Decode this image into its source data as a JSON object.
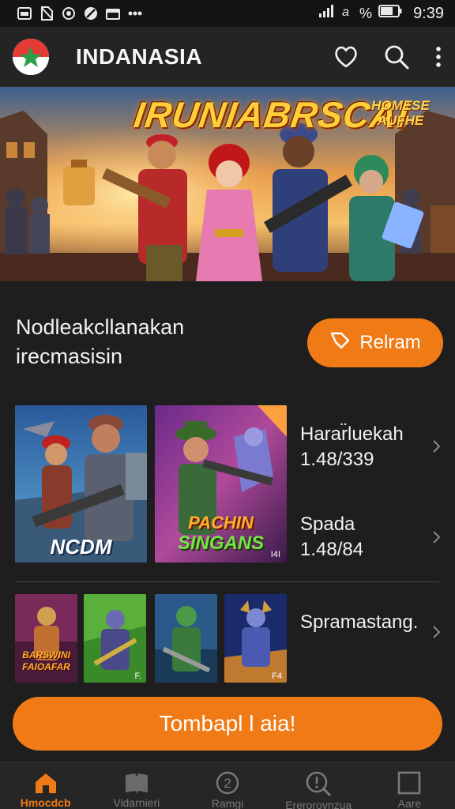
{
  "status_bar": {
    "battery_percent": "%",
    "time": "9:39",
    "icons": [
      "gallery-icon",
      "no-sim-icon",
      "sync-icon",
      "mute-icon",
      "calendar-icon",
      "more-dots-icon",
      "signal-icon",
      "wifi-icon",
      "battery-icon"
    ]
  },
  "app_bar": {
    "title": "INDANASIA",
    "icons": [
      "logo-icon",
      "heart-icon",
      "search-icon",
      "overflow-menu-icon"
    ]
  },
  "hero": {
    "title": "IRUNIABRSCAI",
    "badge_line1": "HOMESE",
    "badge_line2": "AUFHE"
  },
  "promo": {
    "line1": "Nodleakcllanakan",
    "line2": "irecmasisin",
    "button_label": "Relram",
    "button_icon": "tag-icon",
    "accent": "#f07a16"
  },
  "featured": {
    "card1_label": "NCDM",
    "card2_label_line1": "PACHIN",
    "card2_label_line2": "SINGANS",
    "card2_corner": "I4I",
    "item1_title": "Harar̈luekah",
    "item1_value": "1.48/339",
    "item2_title": "Spada",
    "item2_value": "1.48/84"
  },
  "more": {
    "thumb1_label_line1": "BARSWINI",
    "thumb1_label_line2": "FAIOAFAR",
    "thumb2_corner": "F.",
    "thumb4_corner": "F4",
    "title": "Spramastang."
  },
  "cta": {
    "label": "Tombapl l aia!"
  },
  "bottom_nav": {
    "items": [
      {
        "label": "Hmocdcb",
        "icon": "home-icon",
        "active": true
      },
      {
        "label": "Vidarnieri",
        "icon": "library-icon",
        "active": false
      },
      {
        "label": "Ramgi",
        "icon": "help-icon",
        "active": false
      },
      {
        "label": "Ererorovnzua",
        "icon": "search-icon",
        "active": false
      },
      {
        "label": "Aare",
        "icon": "square-icon",
        "active": false
      }
    ]
  }
}
